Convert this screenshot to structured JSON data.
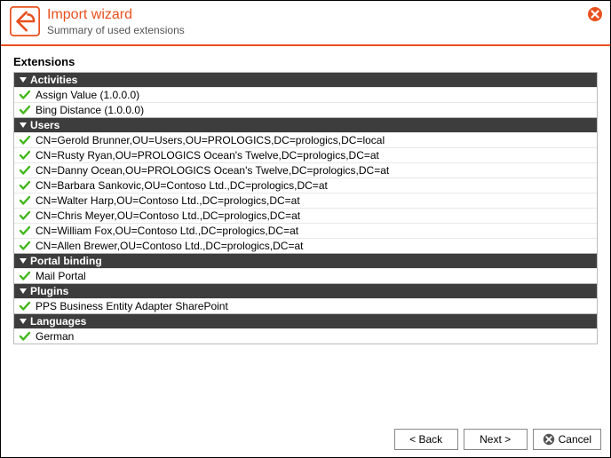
{
  "header": {
    "title": "Import wizard",
    "subtitle": "Summary of used extensions"
  },
  "section_label": "Extensions",
  "groups": [
    {
      "name": "Activities",
      "items": [
        "Assign Value (1.0.0.0)",
        "Bing Distance (1.0.0.0)"
      ]
    },
    {
      "name": "Users",
      "items": [
        "CN=Gerold Brunner,OU=Users,OU=PROLOGICS,DC=prologics,DC=local",
        "CN=Rusty Ryan,OU=PROLOGICS Ocean's Twelve,DC=prologics,DC=at",
        "CN=Danny Ocean,OU=PROLOGICS Ocean's Twelve,DC=prologics,DC=at",
        "CN=Barbara Sankovic,OU=Contoso Ltd.,DC=prologics,DC=at",
        "CN=Walter Harp,OU=Contoso Ltd.,DC=prologics,DC=at",
        "CN=Chris Meyer,OU=Contoso Ltd.,DC=prologics,DC=at",
        "CN=William Fox,OU=Contoso Ltd.,DC=prologics,DC=at",
        "CN=Allen Brewer,OU=Contoso Ltd.,DC=prologics,DC=at"
      ]
    },
    {
      "name": "Portal binding",
      "items": [
        "Mail Portal"
      ]
    },
    {
      "name": "Plugins",
      "items": [
        "PPS Business Entity Adapter SharePoint"
      ]
    },
    {
      "name": "Languages",
      "items": [
        "German"
      ]
    }
  ],
  "footer": {
    "back": "< Back",
    "next": "Next >",
    "cancel": "Cancel"
  },
  "colors": {
    "accent": "#e8501e",
    "ok": "#3fb618",
    "group_bg": "#3d3d3d"
  }
}
